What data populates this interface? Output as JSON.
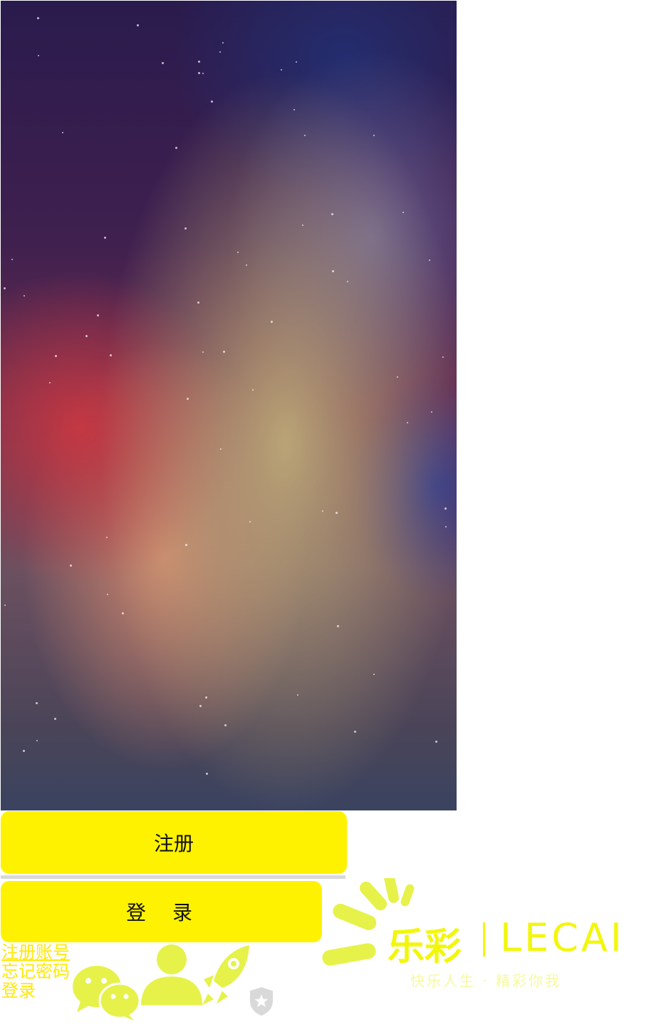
{
  "buttons": {
    "register_label": "注册",
    "login_label": "登 录"
  },
  "links": {
    "register_account": "注册账号",
    "forgot_password": "忘记密码",
    "login": "登录"
  },
  "icons": [
    "wechat-icon",
    "user-icon",
    "rocket-icon",
    "shield-star-icon"
  ],
  "logo": {
    "chinese_name": "乐彩",
    "latin_name": "LECAI",
    "slogan": "快乐人生 · 精彩你我"
  },
  "colors": {
    "accent_yellow": "#fff200",
    "icon_green": "#e6f24a",
    "logo_yellow": "#f2f70a"
  }
}
